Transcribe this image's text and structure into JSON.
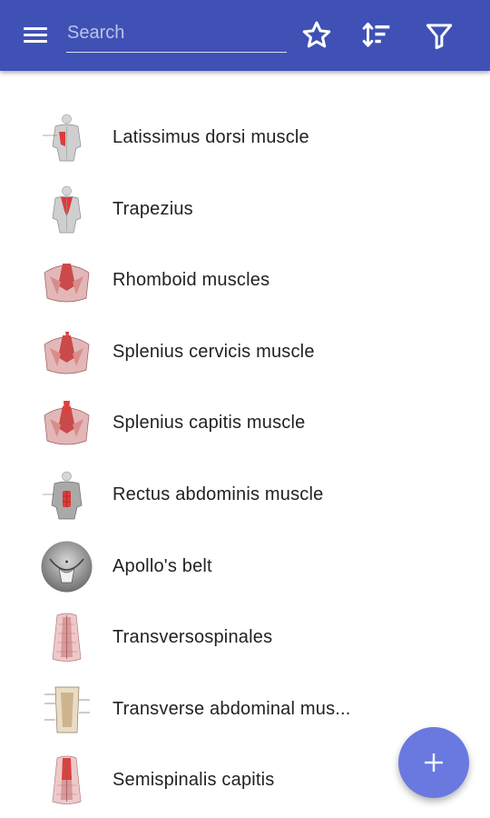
{
  "appbar": {
    "color": "#3f51b5",
    "menu_icon": "menu-icon",
    "search": {
      "placeholder": "Search",
      "value": ""
    },
    "actions": [
      {
        "name": "favorites",
        "icon": "star-outline-icon"
      },
      {
        "name": "sort",
        "icon": "sort-icon"
      },
      {
        "name": "filter",
        "icon": "filter-icon"
      }
    ]
  },
  "list": {
    "items": [
      {
        "label": "Latissimus dorsi muscle",
        "thumb": "back-figure-thumbnail"
      },
      {
        "label": "Trapezius",
        "thumb": "back-figure-thumbnail"
      },
      {
        "label": "Rhomboid muscles",
        "thumb": "shoulder-muscle-thumbnail"
      },
      {
        "label": "Splenius cervicis muscle",
        "thumb": "shoulder-muscle-thumbnail"
      },
      {
        "label": "Splenius capitis muscle",
        "thumb": "shoulder-muscle-thumbnail"
      },
      {
        "label": "Rectus abdominis muscle",
        "thumb": "front-figure-thumbnail"
      },
      {
        "label": "Apollo's belt",
        "thumb": "torso-photo-thumbnail"
      },
      {
        "label": "Transversospinales",
        "thumb": "spine-muscle-thumbnail"
      },
      {
        "label": "Transverse abdominal mus...",
        "thumb": "abdominal-diagram-thumbnail"
      },
      {
        "label": "Semispinalis capitis",
        "thumb": "spine-muscle-thumbnail"
      }
    ]
  },
  "fab": {
    "icon": "plus-icon",
    "color": "#6979e0"
  }
}
